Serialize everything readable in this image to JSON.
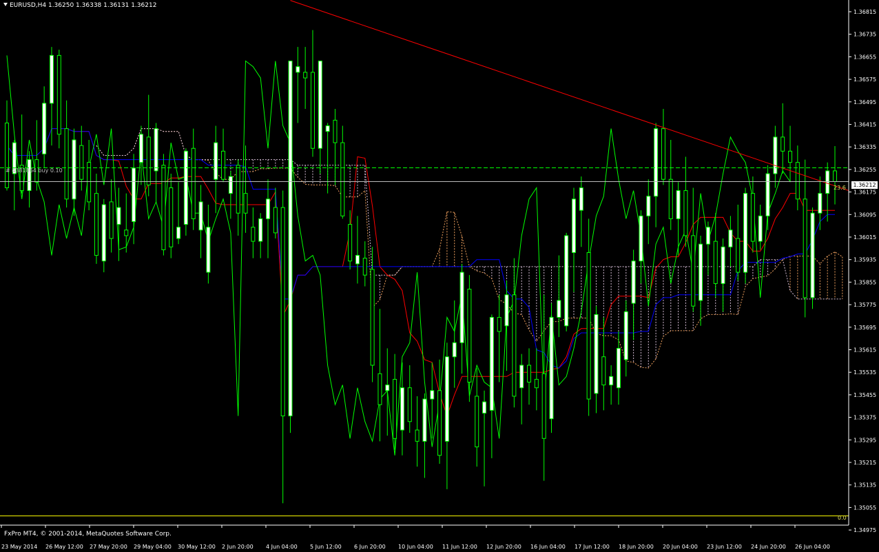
{
  "header": {
    "symbol_line": "EURUSD,H4  1.36250 1.36338 1.36131 1.36212"
  },
  "footer": {
    "copyright": "FxPro MT4, © 2001-2014, MetaQuotes Software Corp."
  },
  "order_label": "# 4381864 buy 0.10",
  "fibo_label": "23.6",
  "fibo_zero_label": "0.0",
  "current_price": "1.36212",
  "price_axis": {
    "labels": [
      "1.36815",
      "1.36735",
      "1.36655",
      "1.36575",
      "1.36495",
      "1.36415",
      "1.36335",
      "1.36255",
      "1.36175",
      "1.36095",
      "1.36015",
      "1.35935",
      "1.35855",
      "1.35775",
      "1.35695",
      "1.35615",
      "1.35535",
      "1.35455",
      "1.35375",
      "1.35295",
      "1.35215",
      "1.35135",
      "1.35055",
      "1.34975"
    ],
    "top_value": 1.36815,
    "step": 0.0008
  },
  "time_axis": {
    "labels": [
      "23 May 2014",
      "26 May 12:00",
      "27 May 20:00",
      "29 May 04:00",
      "30 May 12:00",
      "2 Jun 20:00",
      "4 Jun 04:00",
      "5 Jun 12:00",
      "6 Jun 20:00",
      "10 Jun 04:00",
      "11 Jun 12:00",
      "12 Jun 20:00",
      "16 Jun 04:00",
      "17 Jun 12:00",
      "18 Jun 20:00",
      "20 Jun 04:00",
      "23 Jun 12:00",
      "24 Jun 20:00",
      "26 Jun 04:00"
    ]
  },
  "colors": {
    "background": "#000000",
    "bull_candle": "#ffffff",
    "bear_candle": "#000000",
    "candle_outline": "#00ff00",
    "tenkan": "#ff0000",
    "kijun": "#0000ff",
    "chikou": "#00ff00",
    "cloud_a": "#f4a460",
    "cloud_b": "#d8bfd8",
    "trendline": "#ff0000",
    "fibo": "#ffff00",
    "order_line": "#00ff00"
  },
  "chart_data": {
    "type": "candlestick",
    "symbol": "EURUSD",
    "timeframe": "H4",
    "last_bar": {
      "open": 1.3625,
      "high": 1.36338,
      "low": 1.36131,
      "close": 1.36212
    },
    "ylim": [
      1.34975,
      1.36855
    ],
    "y_ticks": [
      1.36815,
      1.36735,
      1.36655,
      1.36575,
      1.36495,
      1.36415,
      1.36335,
      1.36255,
      1.36175,
      1.36095,
      1.36015,
      1.35935,
      1.35855,
      1.35775,
      1.35695,
      1.35615,
      1.35535,
      1.35455,
      1.35375,
      1.35295,
      1.35215,
      1.35135,
      1.35055,
      1.34975
    ],
    "x_ticks": [
      "23 May 2014",
      "26 May 12:00",
      "27 May 20:00",
      "29 May 04:00",
      "30 May 12:00",
      "2 Jun 20:00",
      "4 Jun 04:00",
      "5 Jun 12:00",
      "6 Jun 20:00",
      "10 Jun 04:00",
      "11 Jun 12:00",
      "12 Jun 20:00",
      "16 Jun 04:00",
      "17 Jun 12:00",
      "18 Jun 20:00",
      "20 Jun 04:00",
      "23 Jun 12:00",
      "24 Jun 20:00",
      "26 Jun 04:00"
    ],
    "candles": [
      {
        "o": 1.3642,
        "h": 1.365,
        "l": 1.3618,
        "c": 1.3619
      },
      {
        "o": 1.3624,
        "h": 1.3636,
        "l": 1.3611,
        "c": 1.3635
      },
      {
        "o": 1.3627,
        "h": 1.3645,
        "l": 1.3617,
        "c": 1.3618
      },
      {
        "o": 1.3618,
        "h": 1.3632,
        "l": 1.3612,
        "c": 1.3629
      },
      {
        "o": 1.3629,
        "h": 1.3643,
        "l": 1.3618,
        "c": 1.3621
      },
      {
        "o": 1.3631,
        "h": 1.3655,
        "l": 1.3626,
        "c": 1.3649
      },
      {
        "o": 1.3649,
        "h": 1.3669,
        "l": 1.3634,
        "c": 1.3666
      },
      {
        "o": 1.3666,
        "h": 1.3668,
        "l": 1.3633,
        "c": 1.3638
      },
      {
        "o": 1.364,
        "h": 1.365,
        "l": 1.3612,
        "c": 1.3615
      },
      {
        "o": 1.3615,
        "h": 1.364,
        "l": 1.3609,
        "c": 1.3636
      },
      {
        "o": 1.3634,
        "h": 1.3641,
        "l": 1.3618,
        "c": 1.3622
      },
      {
        "o": 1.3628,
        "h": 1.3636,
        "l": 1.3611,
        "c": 1.3614
      },
      {
        "o": 1.3617,
        "h": 1.3624,
        "l": 1.3592,
        "c": 1.3595
      },
      {
        "o": 1.3593,
        "h": 1.3615,
        "l": 1.3589,
        "c": 1.3613
      },
      {
        "o": 1.3614,
        "h": 1.3622,
        "l": 1.3596,
        "c": 1.3601
      },
      {
        "o": 1.3606,
        "h": 1.3619,
        "l": 1.3593,
        "c": 1.3612
      },
      {
        "o": 1.3604,
        "h": 1.3617,
        "l": 1.3596,
        "c": 1.3602
      },
      {
        "o": 1.3607,
        "h": 1.3631,
        "l": 1.3599,
        "c": 1.3626
      },
      {
        "o": 1.3628,
        "h": 1.3641,
        "l": 1.362,
        "c": 1.3638
      },
      {
        "o": 1.3637,
        "h": 1.3652,
        "l": 1.3616,
        "c": 1.362
      },
      {
        "o": 1.3625,
        "h": 1.3642,
        "l": 1.3614,
        "c": 1.364
      },
      {
        "o": 1.3627,
        "h": 1.3631,
        "l": 1.3595,
        "c": 1.3597
      },
      {
        "o": 1.3619,
        "h": 1.3624,
        "l": 1.3594,
        "c": 1.3598
      },
      {
        "o": 1.3601,
        "h": 1.3621,
        "l": 1.3599,
        "c": 1.3605
      },
      {
        "o": 1.3606,
        "h": 1.3633,
        "l": 1.3602,
        "c": 1.3632
      },
      {
        "o": 1.3633,
        "h": 1.364,
        "l": 1.3604,
        "c": 1.3608
      },
      {
        "o": 1.3604,
        "h": 1.362,
        "l": 1.3594,
        "c": 1.3614
      },
      {
        "o": 1.3589,
        "h": 1.3613,
        "l": 1.3585,
        "c": 1.3605
      },
      {
        "o": 1.3622,
        "h": 1.3641,
        "l": 1.361,
        "c": 1.3635
      },
      {
        "o": 1.3632,
        "h": 1.364,
        "l": 1.3621,
        "c": 1.3622
      },
      {
        "o": 1.3617,
        "h": 1.3625,
        "l": 1.3608,
        "c": 1.3623
      },
      {
        "o": 1.3627,
        "h": 1.3629,
        "l": 1.3602,
        "c": 1.361
      },
      {
        "o": 1.3617,
        "h": 1.3634,
        "l": 1.3603,
        "c": 1.361
      },
      {
        "o": 1.3605,
        "h": 1.3612,
        "l": 1.3594,
        "c": 1.36
      },
      {
        "o": 1.36,
        "h": 1.361,
        "l": 1.3594,
        "c": 1.3608
      },
      {
        "o": 1.3608,
        "h": 1.3622,
        "l": 1.3594,
        "c": 1.3615
      },
      {
        "o": 1.3612,
        "h": 1.3619,
        "l": 1.3601,
        "c": 1.3603
      },
      {
        "o": 1.3612,
        "h": 1.3618,
        "l": 1.3507,
        "c": 1.3538
      },
      {
        "o": 1.3538,
        "h": 1.3651,
        "l": 1.3532,
        "c": 1.3664
      },
      {
        "o": 1.366,
        "h": 1.3669,
        "l": 1.3642,
        "c": 1.3662
      },
      {
        "o": 1.366,
        "h": 1.3669,
        "l": 1.3647,
        "c": 1.3658
      },
      {
        "o": 1.366,
        "h": 1.3675,
        "l": 1.363,
        "c": 1.3633
      },
      {
        "o": 1.3633,
        "h": 1.3653,
        "l": 1.3624,
        "c": 1.3664
      },
      {
        "o": 1.3639,
        "h": 1.3642,
        "l": 1.3617,
        "c": 1.3641
      },
      {
        "o": 1.3643,
        "h": 1.3647,
        "l": 1.362,
        "c": 1.3635
      },
      {
        "o": 1.3635,
        "h": 1.3641,
        "l": 1.3608,
        "c": 1.3609
      },
      {
        "o": 1.3606,
        "h": 1.3611,
        "l": 1.359,
        "c": 1.3593
      },
      {
        "o": 1.3592,
        "h": 1.3609,
        "l": 1.3585,
        "c": 1.3595
      },
      {
        "o": 1.3594,
        "h": 1.36,
        "l": 1.3584,
        "c": 1.3588
      },
      {
        "o": 1.359,
        "h": 1.3598,
        "l": 1.355,
        "c": 1.3556
      },
      {
        "o": 1.3553,
        "h": 1.3576,
        "l": 1.3529,
        "c": 1.3542
      },
      {
        "o": 1.3547,
        "h": 1.3562,
        "l": 1.3531,
        "c": 1.3549
      },
      {
        "o": 1.3551,
        "h": 1.356,
        "l": 1.3526,
        "c": 1.353
      },
      {
        "o": 1.3533,
        "h": 1.3557,
        "l": 1.3524,
        "c": 1.3548
      },
      {
        "o": 1.3548,
        "h": 1.3556,
        "l": 1.3532,
        "c": 1.3536
      },
      {
        "o": 1.3533,
        "h": 1.3545,
        "l": 1.352,
        "c": 1.3529
      },
      {
        "o": 1.3529,
        "h": 1.3546,
        "l": 1.3516,
        "c": 1.3544
      },
      {
        "o": 1.3544,
        "h": 1.3557,
        "l": 1.353,
        "c": 1.3547
      },
      {
        "o": 1.3547,
        "h": 1.3558,
        "l": 1.3521,
        "c": 1.3524
      },
      {
        "o": 1.3529,
        "h": 1.3564,
        "l": 1.3512,
        "c": 1.3559
      },
      {
        "o": 1.3559,
        "h": 1.3579,
        "l": 1.3548,
        "c": 1.3564
      },
      {
        "o": 1.3564,
        "h": 1.3592,
        "l": 1.3553,
        "c": 1.3589
      },
      {
        "o": 1.3583,
        "h": 1.3588,
        "l": 1.3543,
        "c": 1.355
      },
      {
        "o": 1.3545,
        "h": 1.3555,
        "l": 1.352,
        "c": 1.3527
      },
      {
        "o": 1.3539,
        "h": 1.3547,
        "l": 1.3513,
        "c": 1.3543
      },
      {
        "o": 1.354,
        "h": 1.3574,
        "l": 1.3523,
        "c": 1.3573
      },
      {
        "o": 1.3573,
        "h": 1.3581,
        "l": 1.355,
        "c": 1.3568
      },
      {
        "o": 1.357,
        "h": 1.3586,
        "l": 1.3554,
        "c": 1.3581
      },
      {
        "o": 1.3581,
        "h": 1.3594,
        "l": 1.3541,
        "c": 1.3545
      },
      {
        "o": 1.3548,
        "h": 1.356,
        "l": 1.3535,
        "c": 1.3556
      },
      {
        "o": 1.3556,
        "h": 1.3562,
        "l": 1.3542,
        "c": 1.355
      },
      {
        "o": 1.3551,
        "h": 1.3562,
        "l": 1.354,
        "c": 1.3548
      },
      {
        "o": 1.3553,
        "h": 1.3581,
        "l": 1.3515,
        "c": 1.353
      },
      {
        "o": 1.3537,
        "h": 1.3578,
        "l": 1.3532,
        "c": 1.3573
      },
      {
        "o": 1.3573,
        "h": 1.3595,
        "l": 1.3566,
        "c": 1.3579
      },
      {
        "o": 1.357,
        "h": 1.3603,
        "l": 1.3568,
        "c": 1.3602
      },
      {
        "o": 1.3596,
        "h": 1.3619,
        "l": 1.3582,
        "c": 1.3615
      },
      {
        "o": 1.3611,
        "h": 1.3623,
        "l": 1.3598,
        "c": 1.3619
      },
      {
        "o": 1.3596,
        "h": 1.3608,
        "l": 1.3538,
        "c": 1.3544
      },
      {
        "o": 1.3546,
        "h": 1.3577,
        "l": 1.3539,
        "c": 1.3574
      },
      {
        "o": 1.3559,
        "h": 1.3573,
        "l": 1.354,
        "c": 1.3549
      },
      {
        "o": 1.3549,
        "h": 1.3556,
        "l": 1.3542,
        "c": 1.3552
      },
      {
        "o": 1.3548,
        "h": 1.3568,
        "l": 1.3542,
        "c": 1.3562
      },
      {
        "o": 1.3558,
        "h": 1.3579,
        "l": 1.3552,
        "c": 1.3575
      },
      {
        "o": 1.3578,
        "h": 1.3597,
        "l": 1.3565,
        "c": 1.3593
      },
      {
        "o": 1.3593,
        "h": 1.3611,
        "l": 1.3585,
        "c": 1.3609
      },
      {
        "o": 1.3609,
        "h": 1.3622,
        "l": 1.3599,
        "c": 1.3616
      },
      {
        "o": 1.3616,
        "h": 1.3642,
        "l": 1.3605,
        "c": 1.364
      },
      {
        "o": 1.364,
        "h": 1.3647,
        "l": 1.362,
        "c": 1.3622
      },
      {
        "o": 1.3622,
        "h": 1.3636,
        "l": 1.3604,
        "c": 1.3608
      },
      {
        "o": 1.3608,
        "h": 1.3621,
        "l": 1.3595,
        "c": 1.3618
      },
      {
        "o": 1.3618,
        "h": 1.363,
        "l": 1.3598,
        "c": 1.3602
      },
      {
        "o": 1.3602,
        "h": 1.3619,
        "l": 1.3575,
        "c": 1.3577
      },
      {
        "o": 1.3579,
        "h": 1.3602,
        "l": 1.357,
        "c": 1.3599
      },
      {
        "o": 1.3599,
        "h": 1.3607,
        "l": 1.3588,
        "c": 1.3605
      },
      {
        "o": 1.36,
        "h": 1.361,
        "l": 1.358,
        "c": 1.3585
      },
      {
        "o": 1.3585,
        "h": 1.3601,
        "l": 1.3575,
        "c": 1.3598
      },
      {
        "o": 1.3598,
        "h": 1.3609,
        "l": 1.3591,
        "c": 1.3604
      },
      {
        "o": 1.3601,
        "h": 1.3613,
        "l": 1.3586,
        "c": 1.3589
      },
      {
        "o": 1.3589,
        "h": 1.3619,
        "l": 1.3585,
        "c": 1.3617
      },
      {
        "o": 1.3617,
        "h": 1.3623,
        "l": 1.3596,
        "c": 1.36
      },
      {
        "o": 1.36,
        "h": 1.3613,
        "l": 1.3597,
        "c": 1.3609
      },
      {
        "o": 1.3609,
        "h": 1.3627,
        "l": 1.3604,
        "c": 1.3624
      },
      {
        "o": 1.3624,
        "h": 1.3641,
        "l": 1.3619,
        "c": 1.3637
      },
      {
        "o": 1.3637,
        "h": 1.3649,
        "l": 1.3624,
        "c": 1.3632
      },
      {
        "o": 1.3632,
        "h": 1.3641,
        "l": 1.3621,
        "c": 1.3628
      },
      {
        "o": 1.3628,
        "h": 1.3634,
        "l": 1.3611,
        "c": 1.3615
      },
      {
        "o": 1.3615,
        "h": 1.3629,
        "l": 1.3573,
        "c": 1.358
      },
      {
        "o": 1.358,
        "h": 1.3612,
        "l": 1.3576,
        "c": 1.361
      },
      {
        "o": 1.361,
        "h": 1.3623,
        "l": 1.3604,
        "c": 1.3617
      },
      {
        "o": 1.3617,
        "h": 1.3628,
        "l": 1.3607,
        "c": 1.3625
      },
      {
        "o": 1.3625,
        "h": 1.36338,
        "l": 1.36131,
        "c": 1.36212
      }
    ],
    "current_price": 1.36212,
    "fibo_levels": [
      {
        "label": "23.6",
        "price": 1.36212
      },
      {
        "label": "0.0",
        "price": 1.35025
      }
    ],
    "order": {
      "label": "# 4381864 buy 0.10",
      "price": 1.36261
    }
  }
}
